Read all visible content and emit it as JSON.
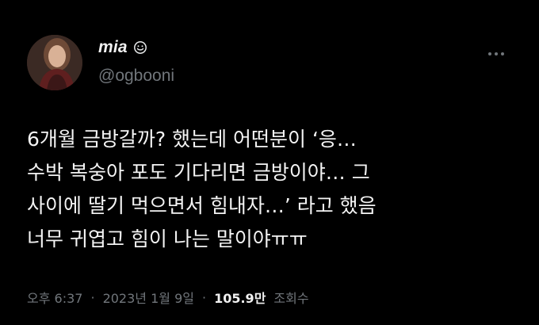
{
  "author": {
    "display_name": "mia",
    "handle": "@ogbooni",
    "name_icon": "smiley-icon",
    "avatar": "avatar"
  },
  "actions": {
    "more_icon": "more-horizontal-icon"
  },
  "tweet": {
    "lines": [
      "6개월 금방갈까? 했는데 어떤분이 ‘응…",
      "수박 복숭아 포도 기다리면 금방이야… 그",
      "사이에 딸기 먹으면서 힘내자…’ 라고 했음",
      "너무 귀엽고 힘이 나는 말이야ㅠㅠ"
    ]
  },
  "meta": {
    "time": "오후 6:37",
    "date": "2023년 1월 9일",
    "separator": "·",
    "views_count": "105.9만",
    "views_label": "조회수"
  },
  "colors": {
    "background": "#000000",
    "text_primary": "#e7e9ea",
    "text_secondary": "#71767b"
  }
}
